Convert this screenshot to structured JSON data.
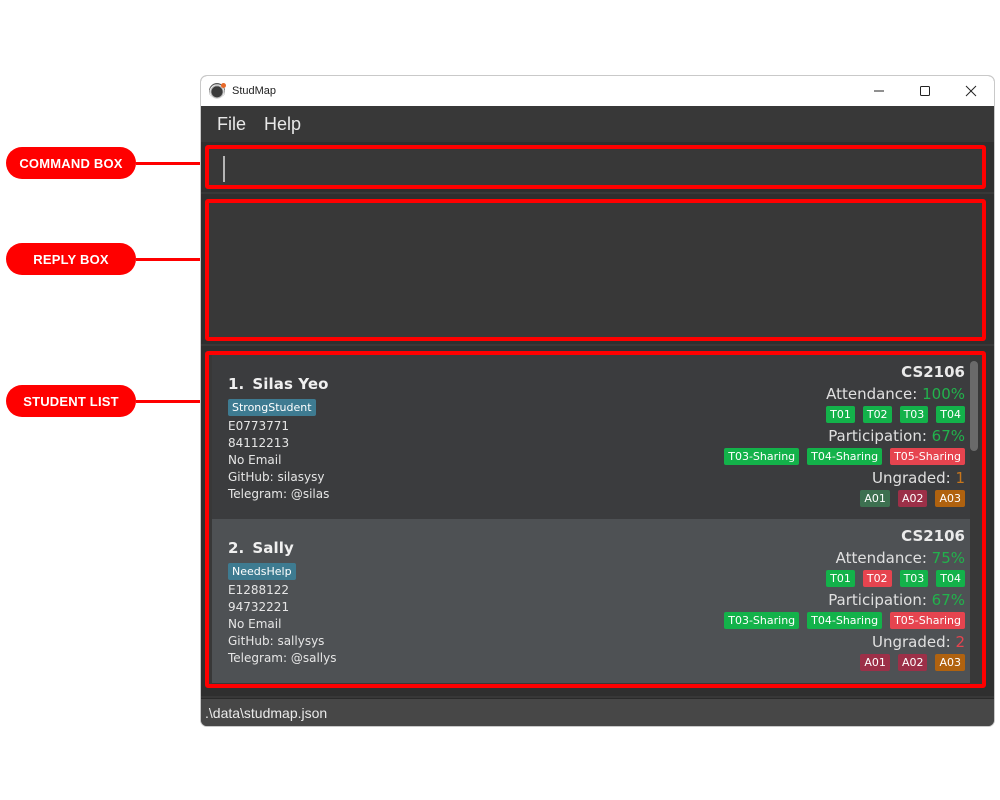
{
  "callouts": [
    {
      "label": "COMMAND BOX"
    },
    {
      "label": "REPLY BOX"
    },
    {
      "label": "STUDENT LIST"
    }
  ],
  "window": {
    "title": "StudMap",
    "controls": {
      "minimize": "minimize-icon",
      "maximize": "maximize-icon",
      "close": "close-icon"
    }
  },
  "menu": [
    {
      "label": "File"
    },
    {
      "label": "Help"
    }
  ],
  "command_box": {
    "value": "",
    "placeholder": ""
  },
  "reply_box": {
    "text": ""
  },
  "students": [
    {
      "index": "1.",
      "name": "Silas Yeo",
      "tag": "StrongStudent",
      "id": "E0773771",
      "phone": "84112213",
      "email": "No Email",
      "github": "GitHub: silasysy",
      "telegram": "Telegram: @silas",
      "module": "CS2106",
      "attendance_label": "Attendance: ",
      "attendance_value": "100%",
      "attendance_color": "#22b24c",
      "attendance": [
        {
          "label": "T01",
          "color": "#13b24a"
        },
        {
          "label": "T02",
          "color": "#13b24a"
        },
        {
          "label": "T03",
          "color": "#13b24a"
        },
        {
          "label": "T04",
          "color": "#13b24a"
        }
      ],
      "participation_label": "Participation: ",
      "participation_value": "67%",
      "participation_color": "#22b24c",
      "participation": [
        {
          "label": "T03-Sharing",
          "color": "#13b24a"
        },
        {
          "label": "T04-Sharing",
          "color": "#13b24a"
        },
        {
          "label": "T05-Sharing",
          "color": "#e6444f"
        }
      ],
      "ungraded_label": "Ungraded: ",
      "ungraded_value": "1",
      "ungraded_color": "#c7761c",
      "assignments": [
        {
          "label": "A01",
          "color": "#3d7050"
        },
        {
          "label": "A02",
          "color": "#9c3048"
        },
        {
          "label": "A03",
          "color": "#b0620f"
        }
      ]
    },
    {
      "index": "2.",
      "name": "Sally",
      "tag": "NeedsHelp",
      "id": "E1288122",
      "phone": "94732221",
      "email": "No Email",
      "github": "GitHub: sallysys",
      "telegram": "Telegram: @sallys",
      "module": "CS2106",
      "attendance_label": "Attendance: ",
      "attendance_value": "75%",
      "attendance_color": "#22b24c",
      "attendance": [
        {
          "label": "T01",
          "color": "#13b24a"
        },
        {
          "label": "T02",
          "color": "#e6444f"
        },
        {
          "label": "T03",
          "color": "#13b24a"
        },
        {
          "label": "T04",
          "color": "#13b24a"
        }
      ],
      "participation_label": "Participation: ",
      "participation_value": "67%",
      "participation_color": "#22b24c",
      "participation": [
        {
          "label": "T03-Sharing",
          "color": "#13b24a"
        },
        {
          "label": "T04-Sharing",
          "color": "#13b24a"
        },
        {
          "label": "T05-Sharing",
          "color": "#e6444f"
        }
      ],
      "ungraded_label": "Ungraded: ",
      "ungraded_value": "2",
      "ungraded_color": "#e6444f",
      "assignments": [
        {
          "label": "A01",
          "color": "#9c3048"
        },
        {
          "label": "A02",
          "color": "#9c3048"
        },
        {
          "label": "A03",
          "color": "#b0620f"
        }
      ]
    }
  ],
  "status_bar": {
    "path": ".\\data\\studmap.json"
  },
  "colors": {
    "accent": "#ff0000",
    "present": "#13b24a",
    "absent": "#e6444f",
    "tag": "#3e7b91"
  }
}
